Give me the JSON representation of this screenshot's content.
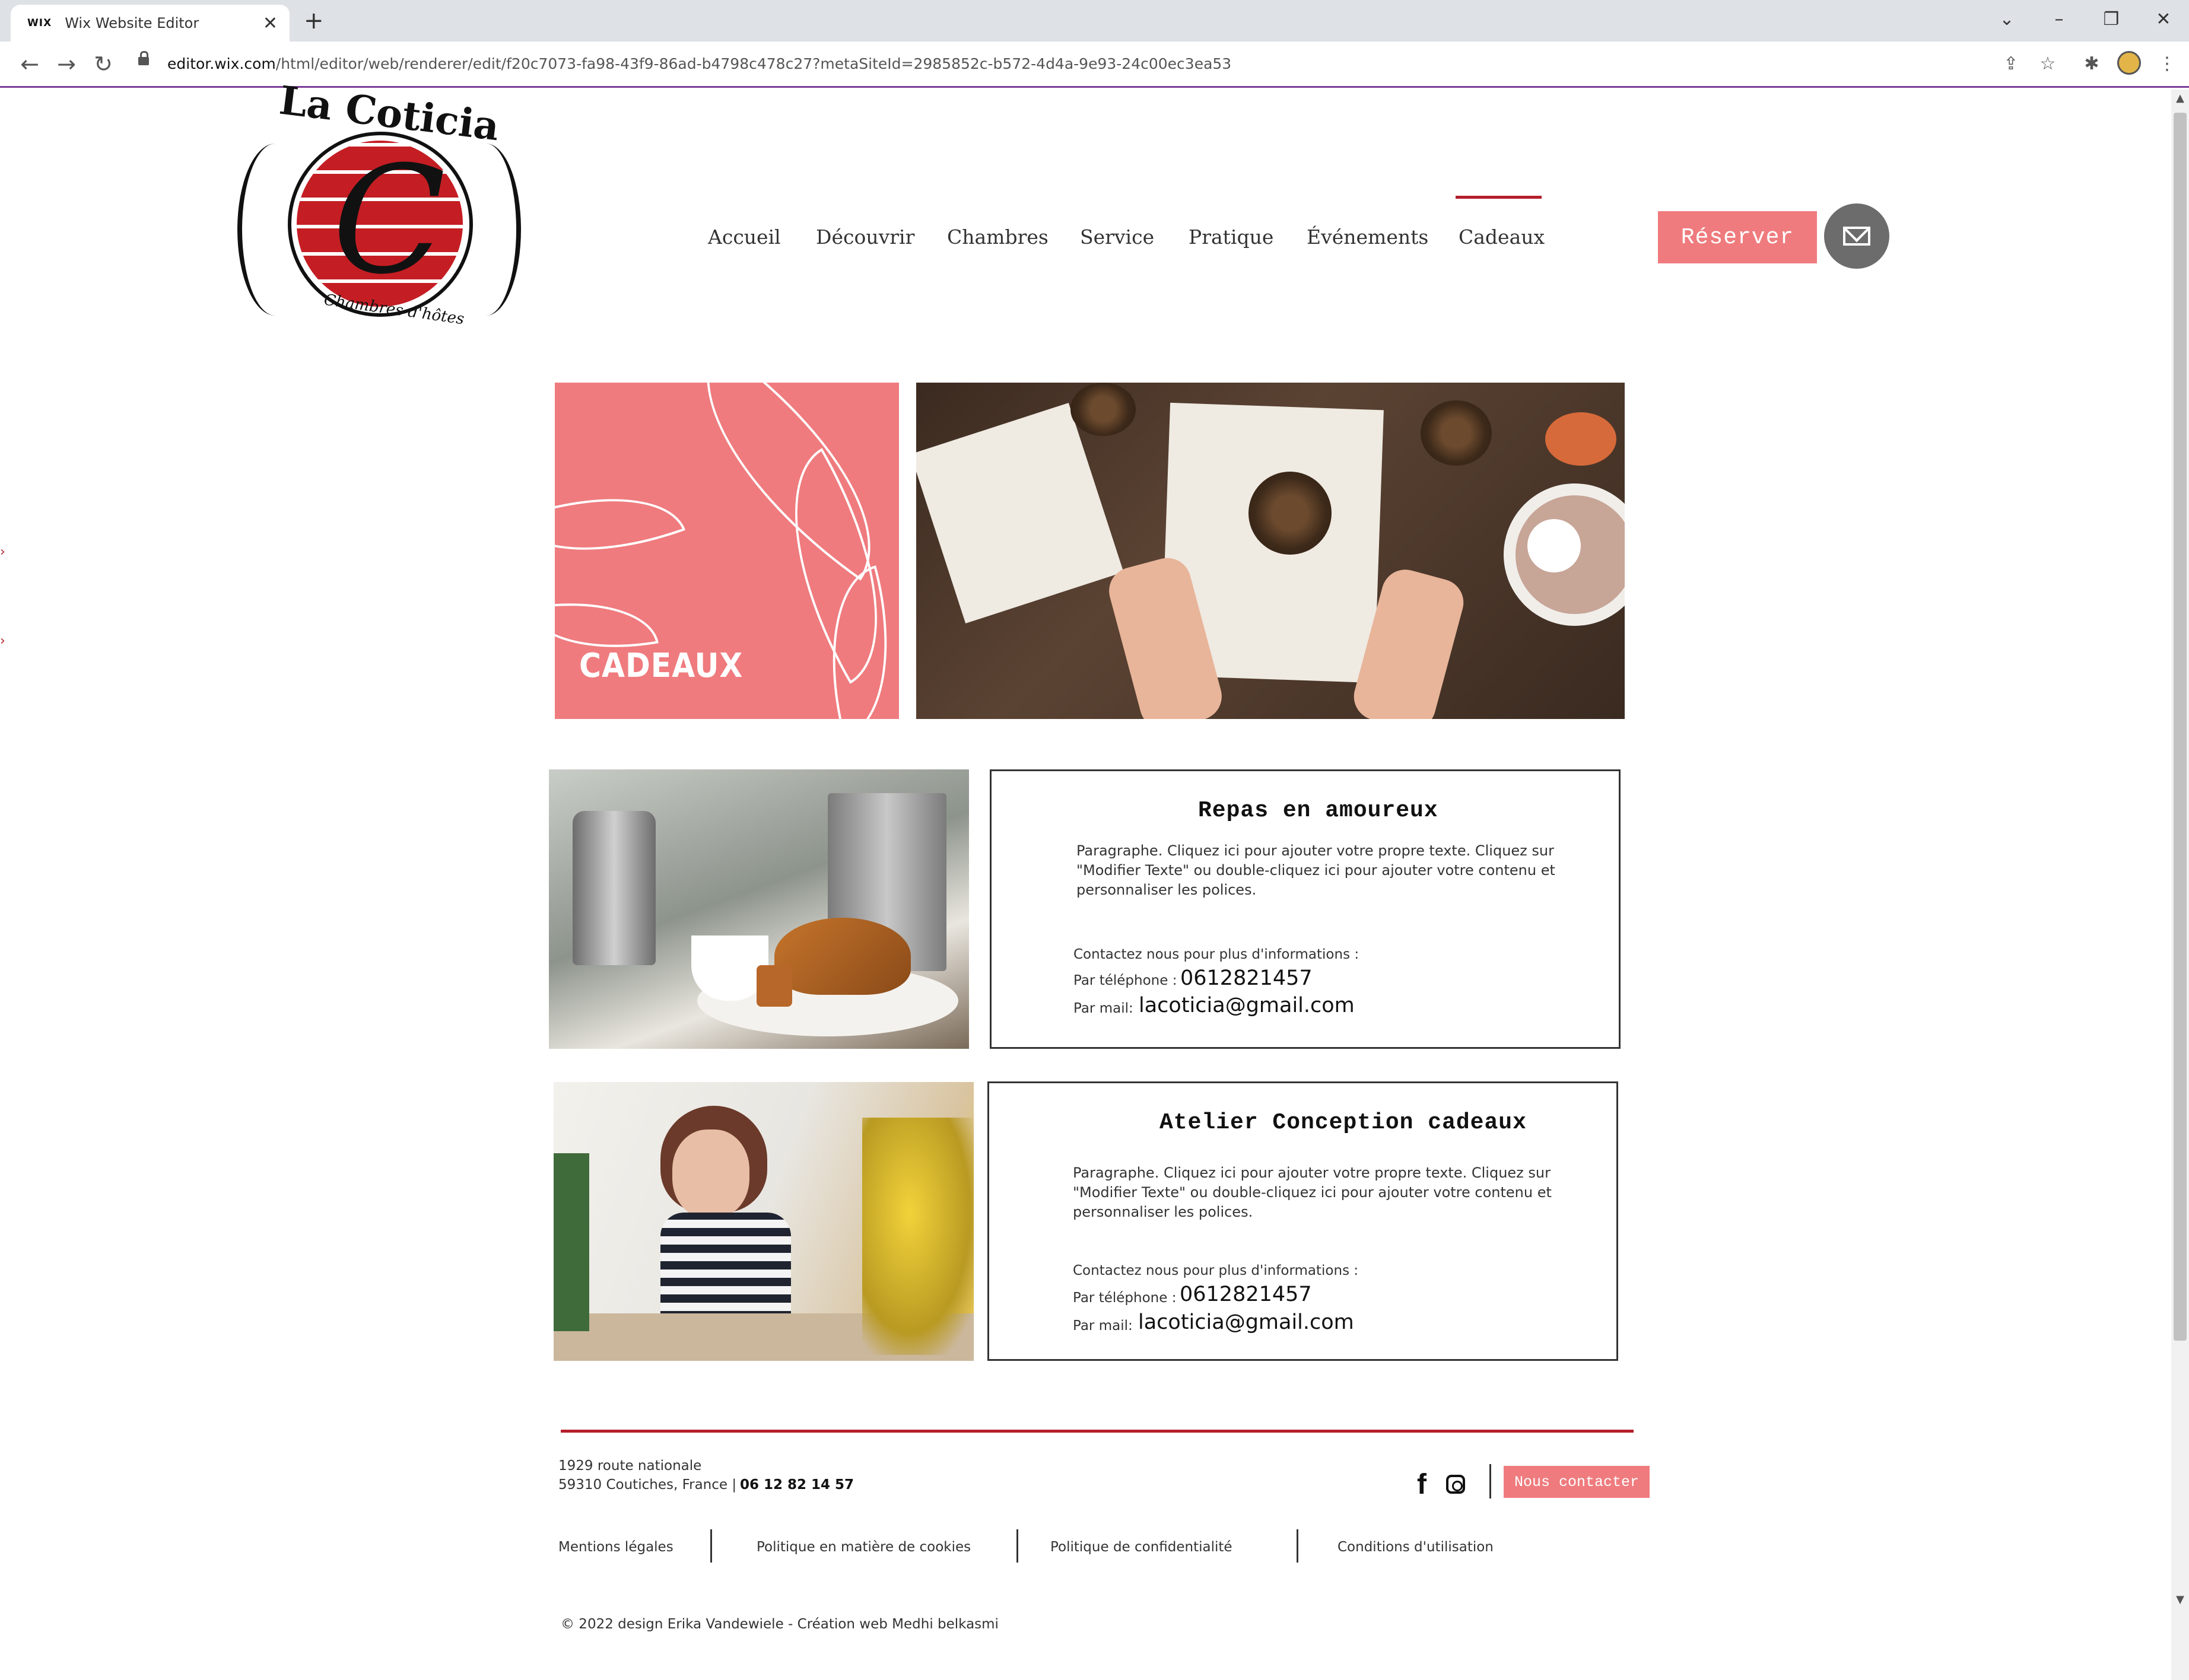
{
  "browser": {
    "tab_favicon": "WIX",
    "tab_title": "Wix Website Editor",
    "tab_close": "✕",
    "new_tab": "+",
    "window_controls": {
      "collapse": "⌄",
      "minimize": "–",
      "restore": "❐",
      "close": "✕"
    },
    "back": "←",
    "forward": "→",
    "reload": "↻",
    "url_domain": "editor.wix.com",
    "url_path": "/html/editor/web/renderer/edit/f20c7073-fa98-43f9-86ad-b4798c478c27?metaSiteId=2985852c-b572-4d4a-9e93-24c00ec3ea53",
    "toolbar_icons": {
      "share": "⇪",
      "bookmark": "☆",
      "extensions": "✱",
      "menu": "⋮"
    },
    "scroll_up": "▲",
    "scroll_down": "▼"
  },
  "site": {
    "logo": {
      "name": "La Coticia",
      "letter": "C",
      "tagline": "Chambres d'hôtes"
    },
    "nav": {
      "items": [
        "Accueil",
        "Découvrir",
        "Chambres",
        "Service",
        "Pratique",
        "Événements",
        "Cadeaux"
      ],
      "active": "Cadeaux"
    },
    "reserve_label": "Réserver",
    "hero": {
      "title": "CADEAUX"
    },
    "cards": [
      {
        "title": "Repas en amoureux",
        "paragraph": "Paragraphe. Cliquez ici pour ajouter votre propre texte. Cliquez sur \"Modifier Texte\" ou double-cliquez ici pour ajouter votre contenu et personnaliser les polices.",
        "contact_intro": "Contactez nous pour plus d'informations :",
        "phone_label": "Par téléphone :",
        "phone": "0612821457",
        "mail_label": "Par mail:",
        "mail": "lacoticia@gmail.com"
      },
      {
        "title": "Atelier Conception cadeaux",
        "paragraph": "Paragraphe. Cliquez ici pour ajouter votre propre texte. Cliquez sur \"Modifier Texte\" ou double-cliquez ici pour ajouter votre contenu et personnaliser les polices.",
        "contact_intro": "Contactez nous pour plus d'informations :",
        "phone_label": "Par téléphone :",
        "phone": "0612821457",
        "mail_label": "Par mail:",
        "mail": "lacoticia@gmail.com"
      }
    ],
    "footer": {
      "address_line1": "1929 route nationale",
      "address_line2": "59310 Coutiches, France |",
      "phone": "06 12 82 14 57",
      "facebook": "f",
      "contact_label": "Nous contacter",
      "legal": [
        "Mentions légales",
        "Politique en matière de cookies",
        "Politique de confidentialité",
        "Conditions d'utilisation"
      ],
      "copyright": "© 2022 design Erika Vandewiele - Création web  Medhi belkasmi"
    }
  },
  "colors": {
    "accent_pink": "#ef7b7e",
    "brand_red": "#b51e2a",
    "chrome_bg": "#dee1e6",
    "editor_purple": "#7d3c98"
  }
}
